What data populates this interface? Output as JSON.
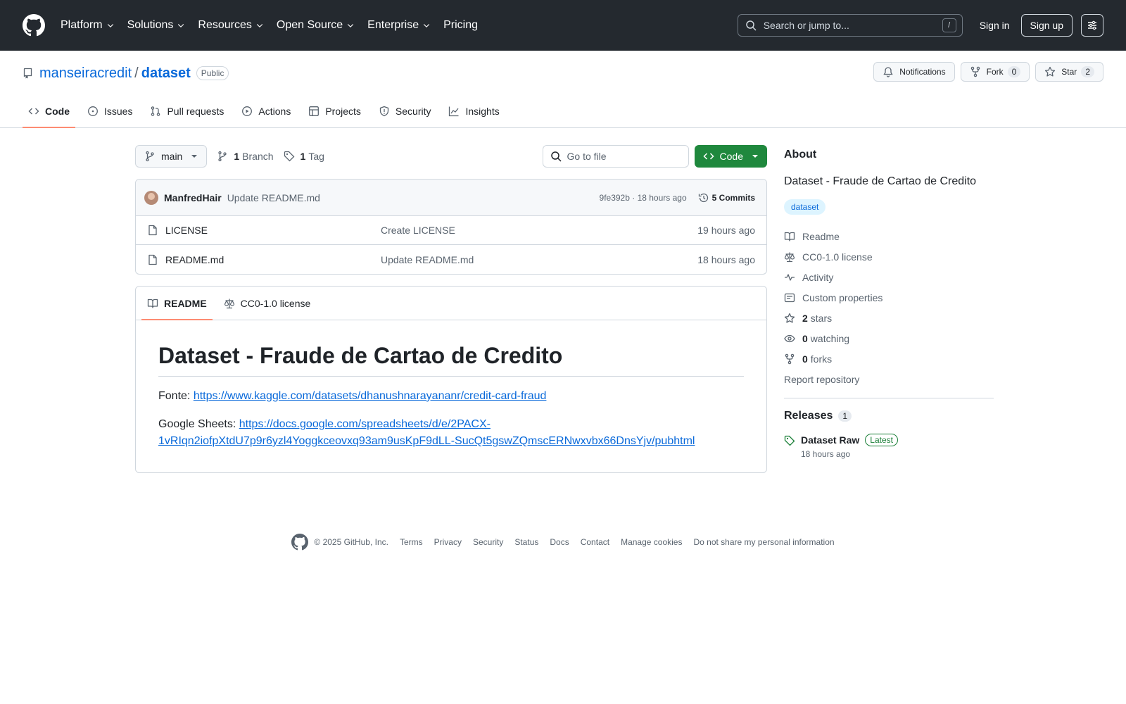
{
  "header": {
    "nav": [
      "Platform",
      "Solutions",
      "Resources",
      "Open Source",
      "Enterprise",
      "Pricing"
    ],
    "search_placeholder": "Search or jump to...",
    "search_key": "/",
    "sign_in": "Sign in",
    "sign_up": "Sign up"
  },
  "repo": {
    "owner": "manseiracredit",
    "separator": "/",
    "name": "dataset",
    "visibility": "Public",
    "notifications": "Notifications",
    "fork_label": "Fork",
    "fork_count": "0",
    "star_label": "Star",
    "star_count": "2",
    "tabs": [
      "Code",
      "Issues",
      "Pull requests",
      "Actions",
      "Projects",
      "Security",
      "Insights"
    ]
  },
  "file_nav": {
    "branch": "main",
    "branch_count": "1",
    "branch_label": "Branch",
    "tag_count": "1",
    "tag_label": "Tag",
    "goto_placeholder": "Go to file",
    "code_button": "Code"
  },
  "latest_commit": {
    "author": "ManfredHair",
    "message": "Update README.md",
    "meta": "9fe392b · 18 hours ago",
    "commits": "5 Commits"
  },
  "files": [
    {
      "name": "LICENSE",
      "commit": "Create LICENSE",
      "time": "19 hours ago"
    },
    {
      "name": "README.md",
      "commit": "Update README.md",
      "time": "18 hours ago"
    }
  ],
  "readme": {
    "tab_readme": "README",
    "tab_license": "CC0-1.0 license",
    "title": "Dataset - Fraude de Cartao de Credito",
    "source_label": "Fonte:",
    "source_url": "https://www.kaggle.com/datasets/dhanushnarayananr/credit-card-fraud",
    "sheets_label": "Google Sheets:",
    "sheets_url_line1": "https://docs.google.com/spreadsheets/d/e/2PACX-",
    "sheets_url_line2": "1vRIqn2iofpXtdU7p9r6yzl4Yoggkceovxq93am9usKpF9dLL-SucQt5gswZQmscERNwxvbx66DnsYjv/pubhtml"
  },
  "about": {
    "heading": "About",
    "description": "Dataset - Fraude de Cartao de Credito",
    "topic": "dataset",
    "readme": "Readme",
    "license": "CC0-1.0 license",
    "activity": "Activity",
    "custom_properties": "Custom properties",
    "stars_count": "2",
    "stars_label": "stars",
    "watching_count": "0",
    "watching_label": "watching",
    "forks_count": "0",
    "forks_label": "forks",
    "report": "Report repository"
  },
  "releases": {
    "heading": "Releases",
    "count": "1",
    "name": "Dataset Raw",
    "badge": "Latest",
    "time": "18 hours ago"
  },
  "footer": {
    "copyright": "© 2025 GitHub, Inc.",
    "links": [
      "Terms",
      "Privacy",
      "Security",
      "Status",
      "Docs",
      "Contact",
      "Manage cookies",
      "Do not share my personal information"
    ]
  },
  "colors": {
    "header_bg": "#24292f",
    "link": "#0969da",
    "primary_button": "#1f883d",
    "active_tab_underline": "#fd8c73"
  }
}
